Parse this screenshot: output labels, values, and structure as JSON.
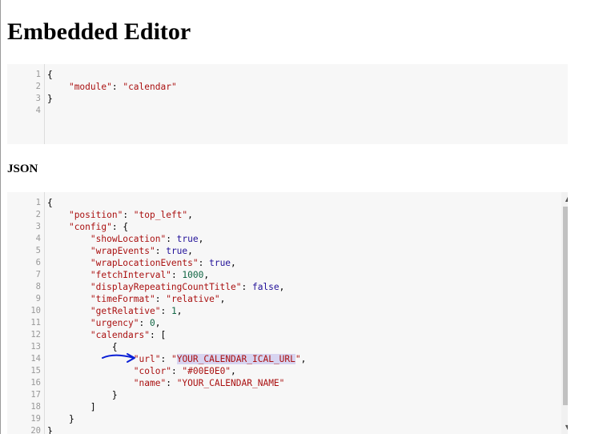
{
  "page": {
    "title": "Embedded Editor",
    "section_label": "JSON"
  },
  "editor_small": {
    "lines": [
      {
        "n": "1",
        "tokens": [
          {
            "t": "{",
            "c": "p"
          }
        ]
      },
      {
        "n": "2",
        "tokens": [
          {
            "t": "    ",
            "c": "p"
          },
          {
            "t": "\"module\"",
            "c": "k"
          },
          {
            "t": ": ",
            "c": "p"
          },
          {
            "t": "\"calendar\"",
            "c": "s"
          }
        ]
      },
      {
        "n": "3",
        "tokens": [
          {
            "t": "}",
            "c": "p"
          }
        ]
      },
      {
        "n": "4",
        "tokens": []
      }
    ]
  },
  "editor_json": {
    "lines": [
      {
        "n": "1",
        "tokens": [
          {
            "t": "{",
            "c": "p"
          }
        ]
      },
      {
        "n": "2",
        "tokens": [
          {
            "t": "    ",
            "c": "p"
          },
          {
            "t": "\"position\"",
            "c": "k"
          },
          {
            "t": ": ",
            "c": "p"
          },
          {
            "t": "\"top_left\"",
            "c": "s"
          },
          {
            "t": ",",
            "c": "p"
          }
        ]
      },
      {
        "n": "3",
        "tokens": [
          {
            "t": "    ",
            "c": "p"
          },
          {
            "t": "\"config\"",
            "c": "k"
          },
          {
            "t": ": {",
            "c": "p"
          }
        ]
      },
      {
        "n": "4",
        "tokens": [
          {
            "t": "        ",
            "c": "p"
          },
          {
            "t": "\"showLocation\"",
            "c": "k"
          },
          {
            "t": ": ",
            "c": "p"
          },
          {
            "t": "true",
            "c": "a"
          },
          {
            "t": ",",
            "c": "p"
          }
        ]
      },
      {
        "n": "5",
        "tokens": [
          {
            "t": "        ",
            "c": "p"
          },
          {
            "t": "\"wrapEvents\"",
            "c": "k"
          },
          {
            "t": ": ",
            "c": "p"
          },
          {
            "t": "true",
            "c": "a"
          },
          {
            "t": ",",
            "c": "p"
          }
        ]
      },
      {
        "n": "6",
        "tokens": [
          {
            "t": "        ",
            "c": "p"
          },
          {
            "t": "\"wrapLocationEvents\"",
            "c": "k"
          },
          {
            "t": ": ",
            "c": "p"
          },
          {
            "t": "true",
            "c": "a"
          },
          {
            "t": ",",
            "c": "p"
          }
        ]
      },
      {
        "n": "7",
        "tokens": [
          {
            "t": "        ",
            "c": "p"
          },
          {
            "t": "\"fetchInterval\"",
            "c": "k"
          },
          {
            "t": ": ",
            "c": "p"
          },
          {
            "t": "1000",
            "c": "n"
          },
          {
            "t": ",",
            "c": "p"
          }
        ]
      },
      {
        "n": "8",
        "tokens": [
          {
            "t": "        ",
            "c": "p"
          },
          {
            "t": "\"displayRepeatingCountTitle\"",
            "c": "k"
          },
          {
            "t": ": ",
            "c": "p"
          },
          {
            "t": "false",
            "c": "a"
          },
          {
            "t": ",",
            "c": "p"
          }
        ]
      },
      {
        "n": "9",
        "tokens": [
          {
            "t": "        ",
            "c": "p"
          },
          {
            "t": "\"timeFormat\"",
            "c": "k"
          },
          {
            "t": ": ",
            "c": "p"
          },
          {
            "t": "\"relative\"",
            "c": "s"
          },
          {
            "t": ",",
            "c": "p"
          }
        ]
      },
      {
        "n": "10",
        "tokens": [
          {
            "t": "        ",
            "c": "p"
          },
          {
            "t": "\"getRelative\"",
            "c": "k"
          },
          {
            "t": ": ",
            "c": "p"
          },
          {
            "t": "1",
            "c": "n"
          },
          {
            "t": ",",
            "c": "p"
          }
        ]
      },
      {
        "n": "11",
        "tokens": [
          {
            "t": "        ",
            "c": "p"
          },
          {
            "t": "\"urgency\"",
            "c": "k"
          },
          {
            "t": ": ",
            "c": "p"
          },
          {
            "t": "0",
            "c": "n"
          },
          {
            "t": ",",
            "c": "p"
          }
        ]
      },
      {
        "n": "12",
        "tokens": [
          {
            "t": "        ",
            "c": "p"
          },
          {
            "t": "\"calendars\"",
            "c": "k"
          },
          {
            "t": ": [",
            "c": "p"
          }
        ]
      },
      {
        "n": "13",
        "tokens": [
          {
            "t": "            {",
            "c": "p"
          }
        ]
      },
      {
        "n": "14",
        "tokens": [
          {
            "t": "                ",
            "c": "p"
          },
          {
            "t": "\"url\"",
            "c": "k"
          },
          {
            "t": ": ",
            "c": "p"
          },
          {
            "t": "\"",
            "c": "s"
          },
          {
            "t": "YOUR_CALENDAR_ICAL_URL",
            "c": "s sel"
          },
          {
            "t": "\"",
            "c": "s"
          },
          {
            "t": ",",
            "c": "p"
          }
        ]
      },
      {
        "n": "15",
        "tokens": [
          {
            "t": "                ",
            "c": "p"
          },
          {
            "t": "\"color\"",
            "c": "k"
          },
          {
            "t": ": ",
            "c": "p"
          },
          {
            "t": "\"#00E0E0\"",
            "c": "s"
          },
          {
            "t": ",",
            "c": "p"
          }
        ]
      },
      {
        "n": "16",
        "tokens": [
          {
            "t": "                ",
            "c": "p"
          },
          {
            "t": "\"name\"",
            "c": "k"
          },
          {
            "t": ": ",
            "c": "p"
          },
          {
            "t": "\"YOUR_CALENDAR_NAME\"",
            "c": "s"
          }
        ]
      },
      {
        "n": "17",
        "tokens": [
          {
            "t": "            }",
            "c": "p"
          }
        ]
      },
      {
        "n": "18",
        "tokens": [
          {
            "t": "        ]",
            "c": "p"
          }
        ]
      },
      {
        "n": "19",
        "tokens": [
          {
            "t": "    }",
            "c": "p"
          }
        ]
      },
      {
        "n": "20",
        "tokens": [
          {
            "t": "}",
            "c": "p"
          }
        ]
      }
    ]
  },
  "scrollbar": {
    "up_icon": "▲",
    "down_icon": "▼"
  },
  "colors": {
    "annotation_arrow": "#0a1fd6",
    "selection": "#d7d4f0"
  },
  "icons": {
    "annotation": "hand-drawn-arrow-icon"
  }
}
